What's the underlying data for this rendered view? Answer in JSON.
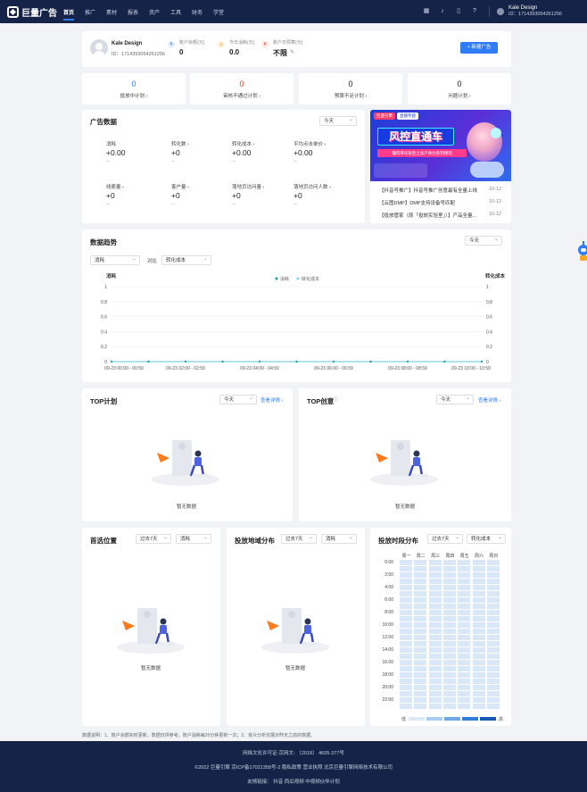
{
  "brand": {
    "name": "巨量广告"
  },
  "nav": {
    "items": [
      "首页",
      "推广",
      "素材",
      "报表",
      "资产",
      "工具",
      "财务",
      "学堂"
    ],
    "user": {
      "name": "Kale Design",
      "id": "ID：1714393054261256"
    }
  },
  "account": {
    "name": "Kale Design",
    "id": "ID：1714393054261256",
    "metrics": [
      {
        "label": "账户余额(元)",
        "value": "0"
      },
      {
        "label": "今日消耗(元)",
        "value": "0.0"
      },
      {
        "label": "账户日预算(元)",
        "value": "不限"
      }
    ],
    "new_button": "+ 新建广告"
  },
  "stats": [
    {
      "value": "0",
      "label": "投放中计划 ›",
      "color": "#2f7cf6"
    },
    {
      "value": "0",
      "label": "审核不通过计划 ›",
      "color": "#e53935"
    },
    {
      "value": "0",
      "label": "预算不足计划 ›",
      "color": "#222222"
    },
    {
      "value": "0",
      "label": "问题计划 ›",
      "color": "#222222"
    }
  ],
  "ad_data": {
    "title": "广告数据",
    "range": "今天",
    "metrics": [
      {
        "label": "消耗",
        "value": "+0.00",
        "sub": "--"
      },
      {
        "label": "转化数 ›",
        "value": "+0",
        "sub": "--"
      },
      {
        "label": "转化成本 ›",
        "value": "+0.00",
        "sub": "--"
      },
      {
        "label": "平均点击单价 ›",
        "value": "+0.00",
        "sub": "--"
      },
      {
        "label": "线索量 ›",
        "value": "+0",
        "sub": "--"
      },
      {
        "label": "客户量 ›",
        "value": "+0",
        "sub": "--"
      },
      {
        "label": "落地页访问量 ›",
        "value": "+0",
        "sub": "--"
      },
      {
        "label": "落地页访问人数 ›",
        "value": "+0",
        "sub": "--"
      }
    ]
  },
  "banner": {
    "top_tags": [
      "巨量引擎",
      "直播专题"
    ],
    "headline": "风控直通车",
    "subline": "懂得审核背后之账户体验系列课程"
  },
  "news": [
    {
      "title": "【抖音号推广】抖音号推广创意最有全量上线",
      "date": "10-12"
    },
    {
      "title": "【云图DMP】DMP支持设备号匹配",
      "date": "10-12"
    },
    {
      "title": "【投放管家（原「投放实验室」）】产品全量...",
      "date": "10-12"
    }
  ],
  "trend": {
    "title": "数据趋势",
    "range": "今天",
    "metric_left": "消耗",
    "compare_label": "对比",
    "metric_right": "转化成本",
    "left_axis_title": "消耗",
    "right_axis_title": "转化成本",
    "legend": [
      "消耗",
      "转化成本"
    ],
    "series_colors": [
      "#1a9fb5",
      "#7fd3e0"
    ]
  },
  "chart_data": {
    "type": "line",
    "x": [
      "09-23 00:00 - 00:59",
      "09-23 01:00 - 01:59",
      "09-23 02:00 - 02:59",
      "09-23 03:00 - 03:59",
      "09-23 04:00 - 04:59",
      "09-23 05:00 - 05:59",
      "09-23 06:00 - 06:59",
      "09-23 07:00 - 07:59",
      "09-23 08:00 - 08:59",
      "09-23 09:00 - 09:59",
      "09-23 10:00 - 10:59"
    ],
    "tick_labels": [
      "09-23 00:00 - 00:59",
      "09-23 02:00 - 02:59",
      "09-23 04:00 - 04:59",
      "09-23 06:00 - 06:59",
      "09-23 08:00 - 08:59",
      "09-23 10:00 - 10:59"
    ],
    "series": [
      {
        "name": "消耗",
        "values": [
          0,
          0,
          0,
          0,
          0,
          0,
          0,
          0,
          0,
          0,
          0
        ]
      },
      {
        "name": "转化成本",
        "values": [
          0,
          0,
          0,
          0,
          0,
          0,
          0,
          0,
          0,
          0,
          0
        ]
      }
    ],
    "yticks": [
      "0",
      "0.2",
      "0.4",
      "0.6",
      "0.8",
      "1"
    ],
    "ylim": [
      0,
      1
    ],
    "ylabel": "消耗",
    "y2label": "转化成本",
    "grid": true,
    "legend_position": "top-center"
  },
  "top_plan": {
    "title": "TOP计划",
    "range": "今天",
    "detail": "查看详情 ›",
    "empty": "暂无数据"
  },
  "top_creative": {
    "title": "TOP创意",
    "range": "今天",
    "detail": "查看详情 ›",
    "empty": "暂无数据"
  },
  "placement": {
    "title": "首选位置",
    "range": "过去7天",
    "metric": "消耗",
    "empty": "暂无数据"
  },
  "region": {
    "title": "投放地域分布",
    "range": "过去7天",
    "metric": "消耗",
    "empty": "暂无数据"
  },
  "time_dist": {
    "title": "投放时段分布",
    "range": "过去7天",
    "metric": "转化成本",
    "days": [
      "周一",
      "周二",
      "周三",
      "周四",
      "周五",
      "周六",
      "周日"
    ],
    "hours": [
      "0:00",
      "2:00",
      "4:00",
      "6:00",
      "8:00",
      "10:00",
      "12:00",
      "14:00",
      "16:00",
      "18:00",
      "20:00",
      "22:00"
    ],
    "legend_low": "低",
    "legend_high": "高"
  },
  "note": "数据说明：1、账户余额实时更新，数据仅供参考。账户消耗每20分钟更新一次；2、受众分析仅展示昨天之前的数据。",
  "footer": {
    "line1": "网络文化许可证-京网文- 〔2018〕 4605-377号",
    "line2": "©2022 巨量引擎  京ICP备17021358号-2    隐私政策    营业执照    北京巨量引擎网络技术有限公司",
    "line3": "友情链接：  抖音  西瓜视频  中视频伙伴计划"
  }
}
